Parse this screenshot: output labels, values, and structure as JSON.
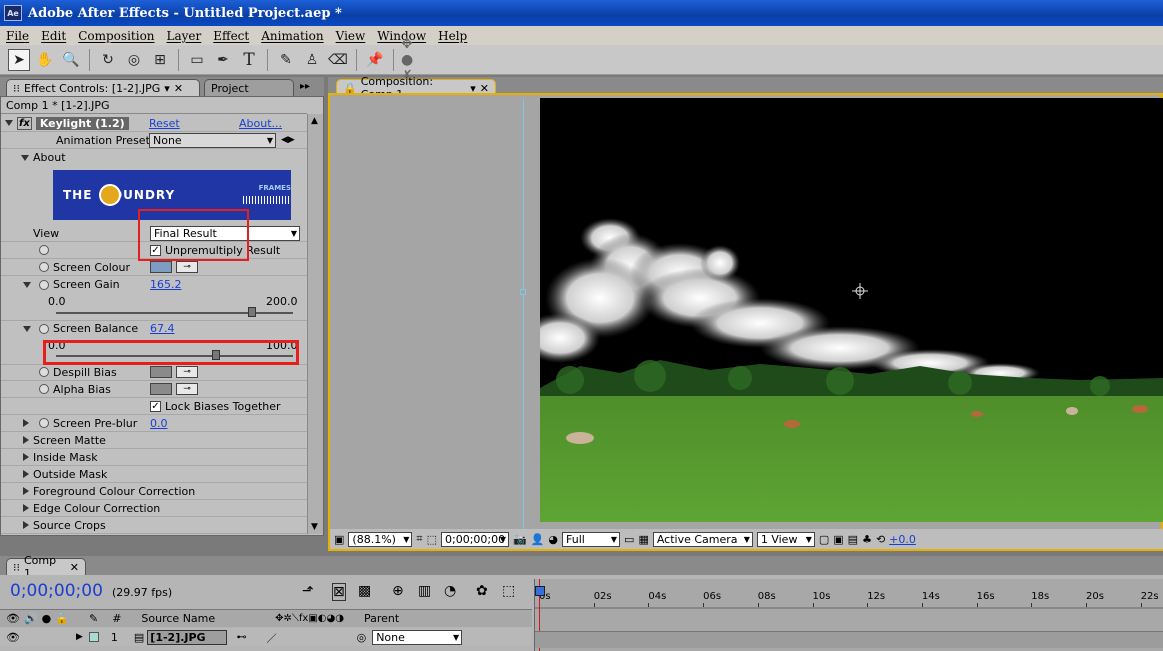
{
  "window": {
    "title": "Adobe After Effects - Untitled Project.aep *",
    "icon": "Ae"
  },
  "menu": [
    "File",
    "Edit",
    "Composition",
    "Layer",
    "Effect",
    "Animation",
    "View",
    "Window",
    "Help"
  ],
  "tools": [
    "selection-tool",
    "hand-tool",
    "zoom-tool",
    "rotate-tool",
    "orbit-camera-tool",
    "pan-behind-tool",
    "rectangle-mask-tool",
    "pen-tool",
    "type-tool",
    "brush-tool",
    "clone-stamp-tool",
    "eraser-tool",
    "puppet-pin-tool"
  ],
  "left_panel": {
    "tab_effect": "Effect Controls: [1-2].JPG",
    "tab_project": "Project",
    "header": "Comp 1 * [1-2].JPG",
    "effect_name": "Keylight (1.2)",
    "reset": "Reset",
    "about_link": "About...",
    "animation_presets_label": "Animation Presets:",
    "animation_presets_value": "None",
    "about": "About",
    "logo_text": "THE  FOUNDRY",
    "logo_side": "FRAMES",
    "view_label": "View",
    "view_value": "Final Result",
    "unpremultiply": "Unpremultiply Result",
    "screen_colour": "Screen Colour",
    "screen_gain": "Screen Gain",
    "screen_gain_value": "165.2",
    "gain_min": "0.0",
    "gain_max": "200.0",
    "gain_level": 0.826,
    "screen_balance": "Screen Balance",
    "screen_balance_value": "67.4",
    "balance_min": "0.0",
    "balance_max": "100.0",
    "balance_level": 0.674,
    "despill_bias": "Despill Bias",
    "alpha_bias": "Alpha Bias",
    "lock_biases": "Lock Biases Together",
    "screen_preblur": "Screen Pre-blur",
    "screen_preblur_value": "0.0",
    "groups": [
      "Screen Matte",
      "Inside Mask",
      "Outside Mask",
      "Foreground Colour Correction",
      "Edge Colour Correction",
      "Source Crops"
    ]
  },
  "comp_panel": {
    "tab": "Composition: Comp 1",
    "zoom": "(88.1%)",
    "timecode": "0;00;00;00",
    "resolution": "Full",
    "camera": "Active Camera",
    "views": "1 View",
    "exposure": "+0.0"
  },
  "timeline": {
    "tab": "Comp 1",
    "timecode": "0;00;00;00",
    "fps": "(29.97 fps)",
    "col_hash": "#",
    "col_source": "Source Name",
    "col_parent": "Parent",
    "layer_num": "1",
    "layer_name": "[1-2].JPG",
    "parent_value": "None",
    "ruler": [
      "0s",
      "02s",
      "04s",
      "06s",
      "08s",
      "10s",
      "12s",
      "14s",
      "16s",
      "18s",
      "20s",
      "22s"
    ]
  },
  "colors": {
    "accent": "#e8b100",
    "highlight": "#e61e1e",
    "link": "#1a3fd0",
    "timecode": "#1a3fd0"
  }
}
